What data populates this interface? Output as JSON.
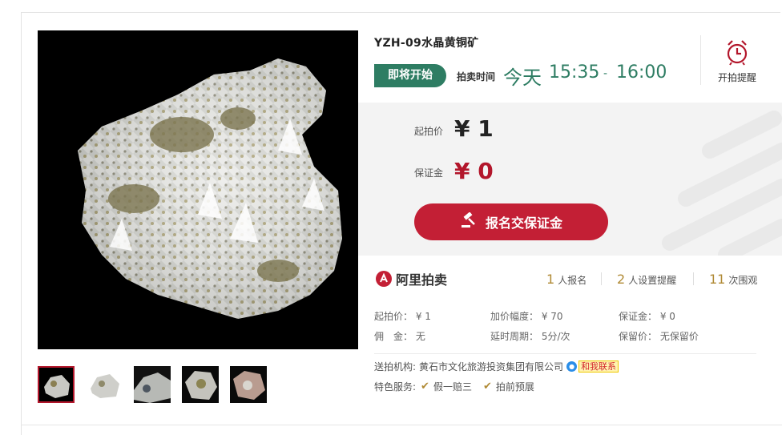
{
  "lot": {
    "title": "YZH-09水晶黄铜矿",
    "status": "即将开始",
    "time_label": "拍卖时间",
    "time_day": "今天",
    "time_start": "15:35",
    "time_dash": "-",
    "time_end": "16:00",
    "remind_label": "开拍提醒"
  },
  "price": {
    "start_label": "起拍价",
    "start_value": "¥ 1",
    "deposit_label": "保证金",
    "deposit_value": "¥ 0",
    "button_label": "报名交保证金"
  },
  "platform": {
    "name": "阿里拍卖"
  },
  "stats": [
    {
      "num": "1",
      "label": "人报名"
    },
    {
      "num": "2",
      "label": "人设置提醒"
    },
    {
      "num": "11",
      "label": "次围观"
    }
  ],
  "details": {
    "start_price": "起拍价： ¥ 1",
    "increment": "加价幅度： ¥ 70",
    "deposit": "保证金： ¥ 0",
    "commission": "佣　金： 无",
    "delay": "延时周期： 5分/次",
    "reserve": "保留价： 无保留价"
  },
  "agency": {
    "label": "送拍机构:",
    "name": "黄石市文化旅游投资集团有限公司",
    "contact": "和我联系"
  },
  "features": {
    "label": "特色服务:",
    "items": [
      "假一赔三",
      "拍前预展"
    ]
  },
  "colors": {
    "green": "#2e7d63",
    "red": "#c31f35",
    "gold": "#b08a35"
  },
  "icons": [
    "alarm-clock-icon",
    "gavel-icon",
    "check-icon",
    "chat-icon",
    "ali-auction-logo"
  ]
}
